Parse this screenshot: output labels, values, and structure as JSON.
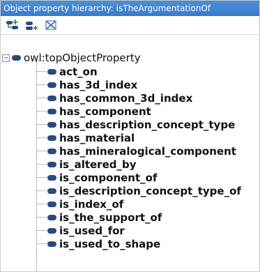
{
  "panel": {
    "title": "Object property hierarchy: isTheArgumentationOf"
  },
  "toolbar": {
    "buttons": [
      {
        "icon": "add-subproperty-icon"
      },
      {
        "icon": "add-sibling-property-icon"
      },
      {
        "icon": "delete-property-icon"
      }
    ]
  },
  "tree": {
    "root": {
      "expander": "−",
      "label": "owl:topObjectProperty"
    },
    "children": [
      {
        "label": "act_on"
      },
      {
        "label": "has_3d_index"
      },
      {
        "label": "has_common_3d_index"
      },
      {
        "label": "has_component"
      },
      {
        "label": "has_description_concept_type"
      },
      {
        "label": "has_material"
      },
      {
        "label": "has_mineralogical_component"
      },
      {
        "label": "is_altered_by"
      },
      {
        "label": "is_component_of"
      },
      {
        "label": "is_description_concept_type_of"
      },
      {
        "label": "is_index_of"
      },
      {
        "label": "is_the_support_of"
      },
      {
        "label": "is_used_for"
      },
      {
        "label": "is_used_to_shape"
      }
    ]
  },
  "colors": {
    "title_bar": "#3a7bc8",
    "property_icon": "#2a4a7c",
    "add_icon_green": "#3a9a4a",
    "delete_icon_blue": "#4a7ab8"
  }
}
